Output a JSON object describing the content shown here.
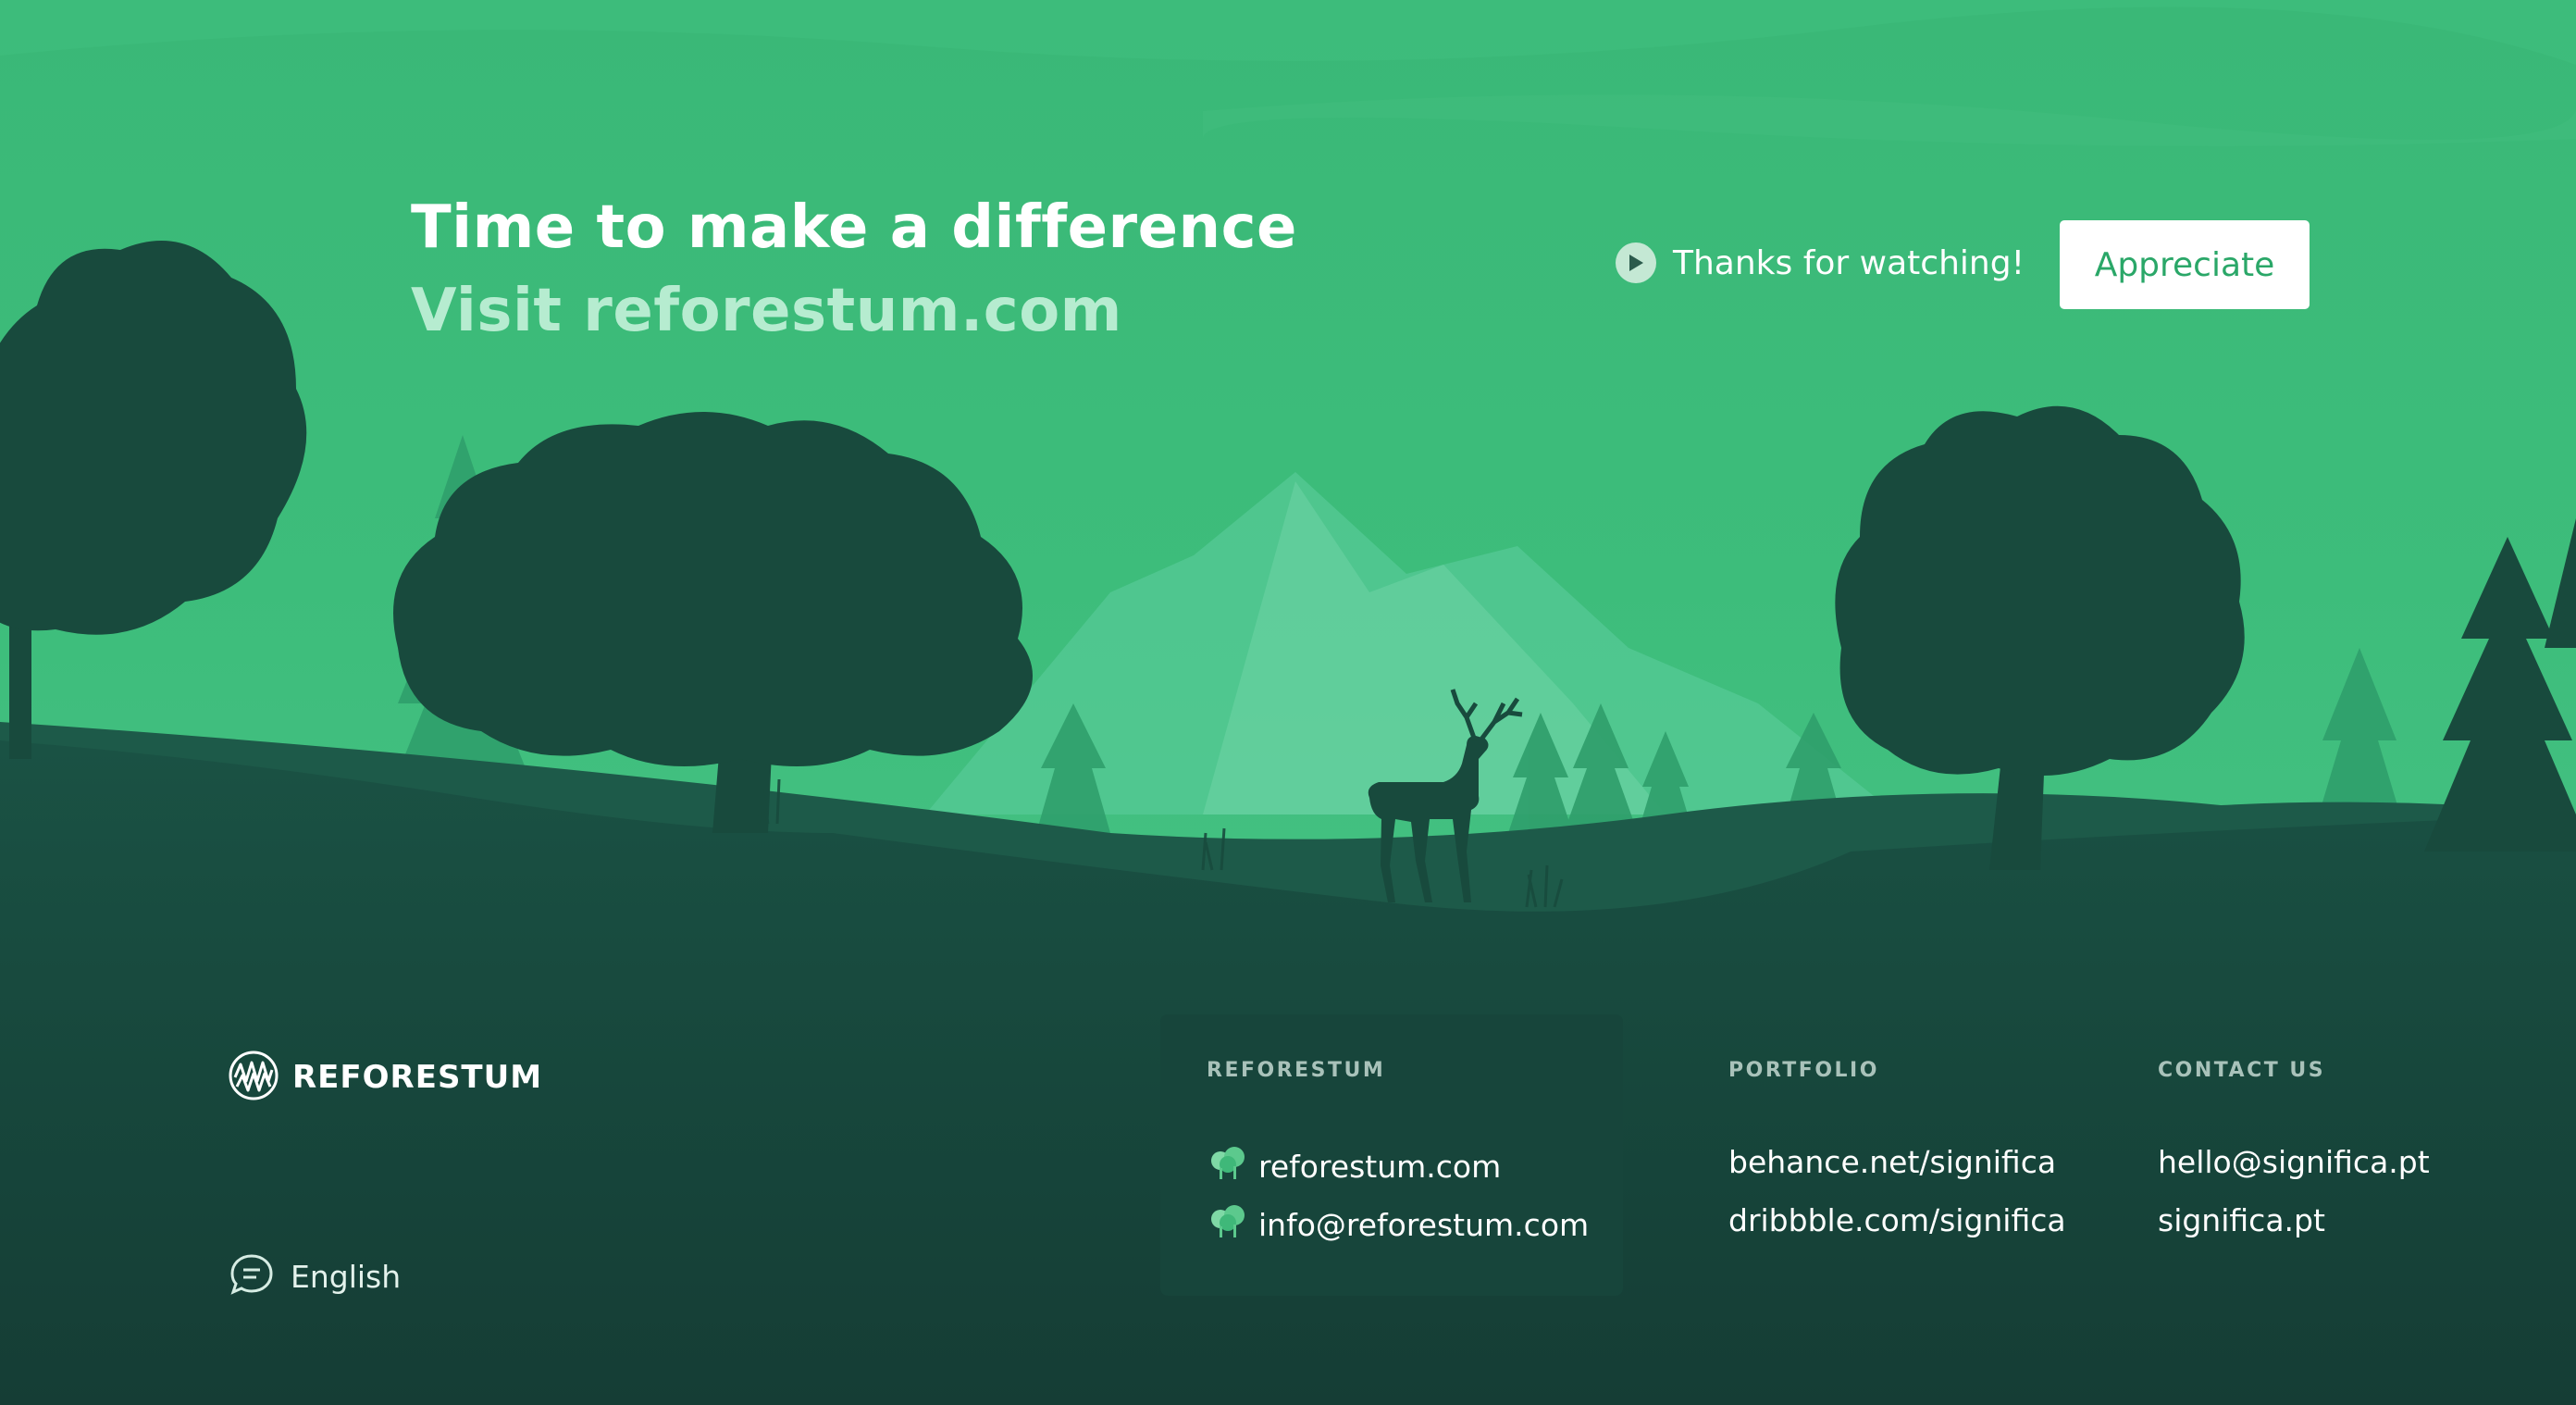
{
  "hero": {
    "headline": "Time to make a difference",
    "subline": "Visit reforestum.com",
    "thanks_text": "Thanks for watching!",
    "appreciate_label": "Appreciate"
  },
  "footer": {
    "brand": "REFORESTUM",
    "language": "English",
    "columns": [
      {
        "title": "REFORESTUM",
        "links": [
          "reforestum.com",
          "info@reforestum.com"
        ]
      },
      {
        "title": "PORTFOLIO",
        "links": [
          "behance.net/significa",
          "dribbble.com/significa"
        ]
      },
      {
        "title": "CONTACT US",
        "links": [
          "hello@significa.pt",
          "significa.pt"
        ]
      }
    ]
  },
  "icons": {
    "play": "play-icon",
    "brand_logo": "reforestum-logo-icon",
    "language": "chat-bubble-icon",
    "link_bullet": "tree-icon"
  },
  "colors": {
    "sky": "#3aba78",
    "foreground": "#17493d",
    "footer_bg": "#153d35",
    "accent": "#2aa768",
    "subline": "#b6ecd0"
  }
}
